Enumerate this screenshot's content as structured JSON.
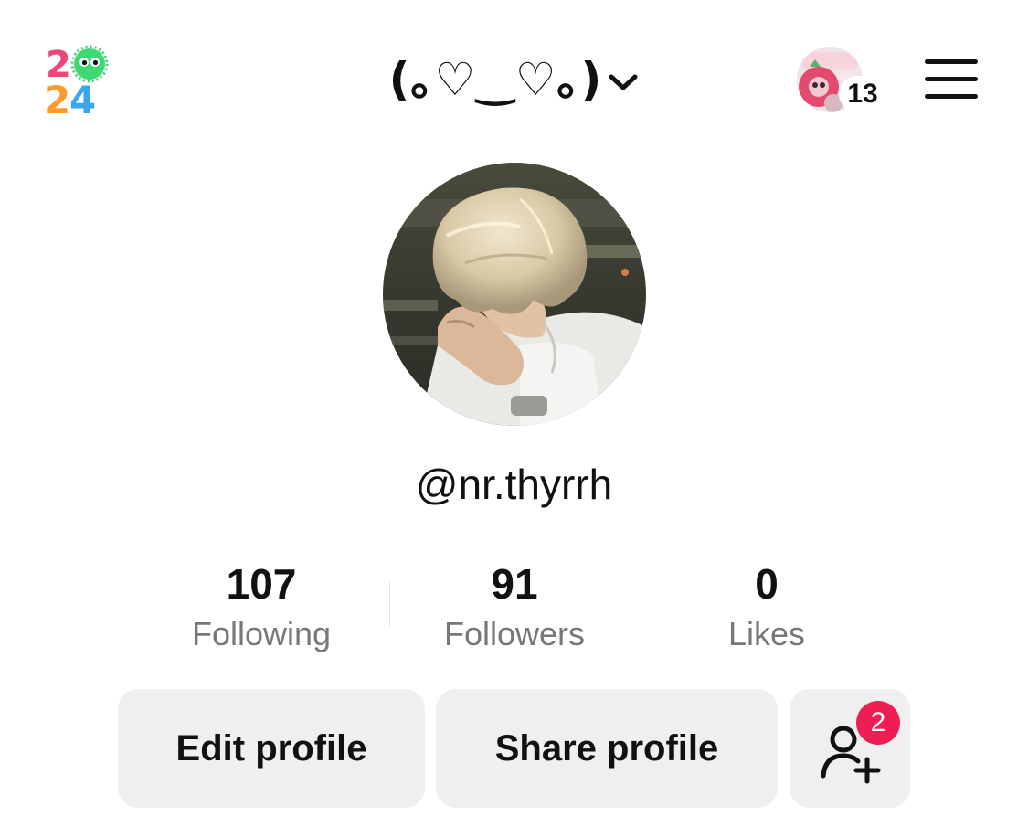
{
  "header": {
    "logo_icon": "2024-year-logo-icon",
    "account_title": "(｡♡‿♡｡)",
    "dropdown_icon": "chevron-down-icon",
    "story_count": "13",
    "menu_icon": "hamburger-menu-icon"
  },
  "profile": {
    "username": "@nr.thyrrh"
  },
  "stats": {
    "following": {
      "value": "107",
      "label": "Following"
    },
    "followers": {
      "value": "91",
      "label": "Followers"
    },
    "likes": {
      "value": "0",
      "label": "Likes"
    }
  },
  "actions": {
    "edit_profile": "Edit profile",
    "share_profile": "Share profile",
    "add_friend_icon": "add-friend-icon",
    "add_friend_badge": "2"
  },
  "colors": {
    "badge": "#ee1d52",
    "button_bg": "#efefef",
    "muted_text": "#787878"
  }
}
